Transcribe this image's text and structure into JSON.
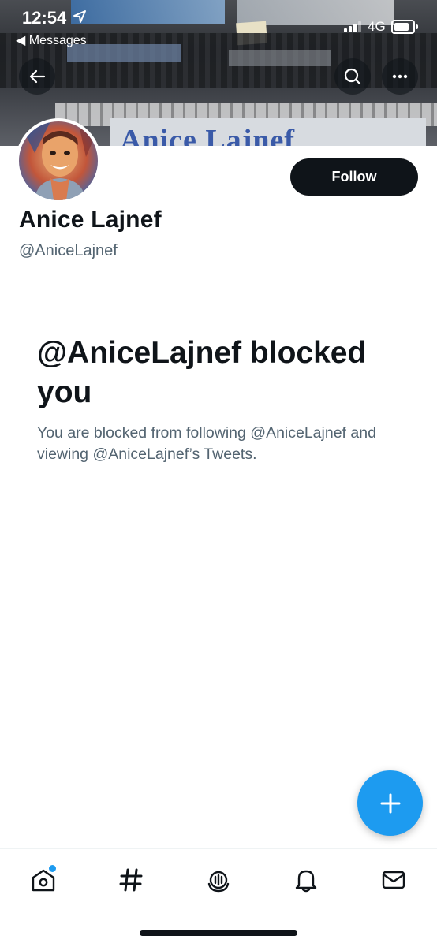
{
  "status_bar": {
    "time": "12:54",
    "back_app": "◀ Messages",
    "network": "4G"
  },
  "profile": {
    "banner_text": "Anice Lajnef",
    "display_name": "Anice Lajnef",
    "handle": "@AniceLajnef",
    "follow_label": "Follow"
  },
  "blocked": {
    "title": "@AniceLajnef blocked you",
    "description": "You are blocked from following @AniceLajnef and viewing @AniceLajnef’s Tweets."
  },
  "icons": {
    "back": "arrow-left-icon",
    "search": "search-icon",
    "more": "more-icon",
    "compose": "plus-icon",
    "nav": [
      "home-icon",
      "hashtag-icon",
      "spaces-icon",
      "bell-icon",
      "mail-icon"
    ]
  },
  "colors": {
    "accent": "#1d9bf0",
    "text": "#0f1419",
    "secondary": "#536471"
  },
  "nav": {
    "home_has_notification": true
  }
}
